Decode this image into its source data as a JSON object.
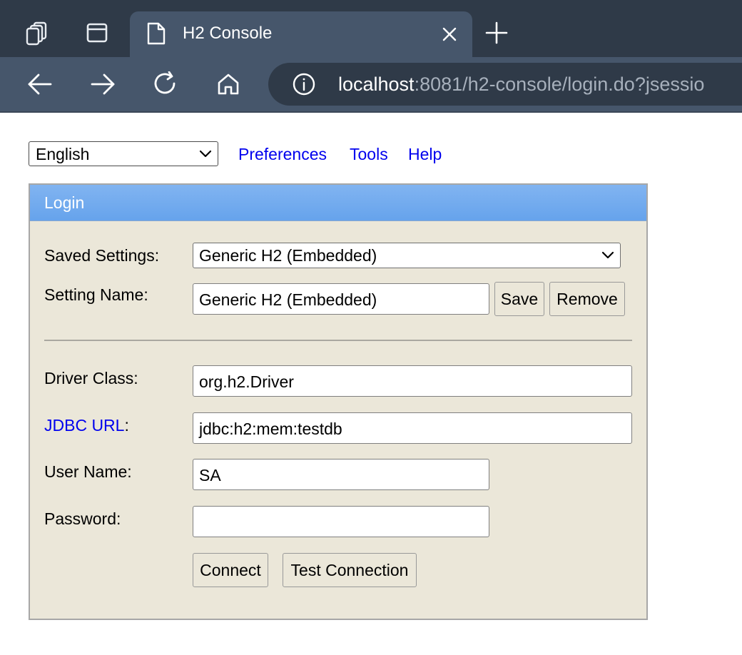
{
  "browser": {
    "tab_title": "H2 Console",
    "url_host": "localhost",
    "url_rest": ":8081/h2-console/login.do?jsessio"
  },
  "toolbar": {
    "language": "English",
    "links": [
      "Preferences",
      "Tools",
      "Help"
    ]
  },
  "login": {
    "title": "Login",
    "saved_settings_label": "Saved Settings:",
    "saved_settings_value": "Generic H2 (Embedded)",
    "setting_name_label": "Setting Name:",
    "setting_name_value": "Generic H2 (Embedded)",
    "save_label": "Save",
    "remove_label": "Remove",
    "driver_class_label": "Driver Class:",
    "driver_class_value": "org.h2.Driver",
    "jdbc_url_label": "JDBC URL",
    "jdbc_url_colon": ":",
    "jdbc_url_value": "jdbc:h2:mem:testdb",
    "user_name_label": "User Name:",
    "user_name_value": "SA",
    "password_label": "Password:",
    "password_value": "",
    "connect_label": "Connect",
    "test_connection_label": "Test Connection"
  },
  "colors": {
    "header_gradient_top": "#81b4f1",
    "panel_bg": "#ebe7d9",
    "link": "#0000ee"
  }
}
